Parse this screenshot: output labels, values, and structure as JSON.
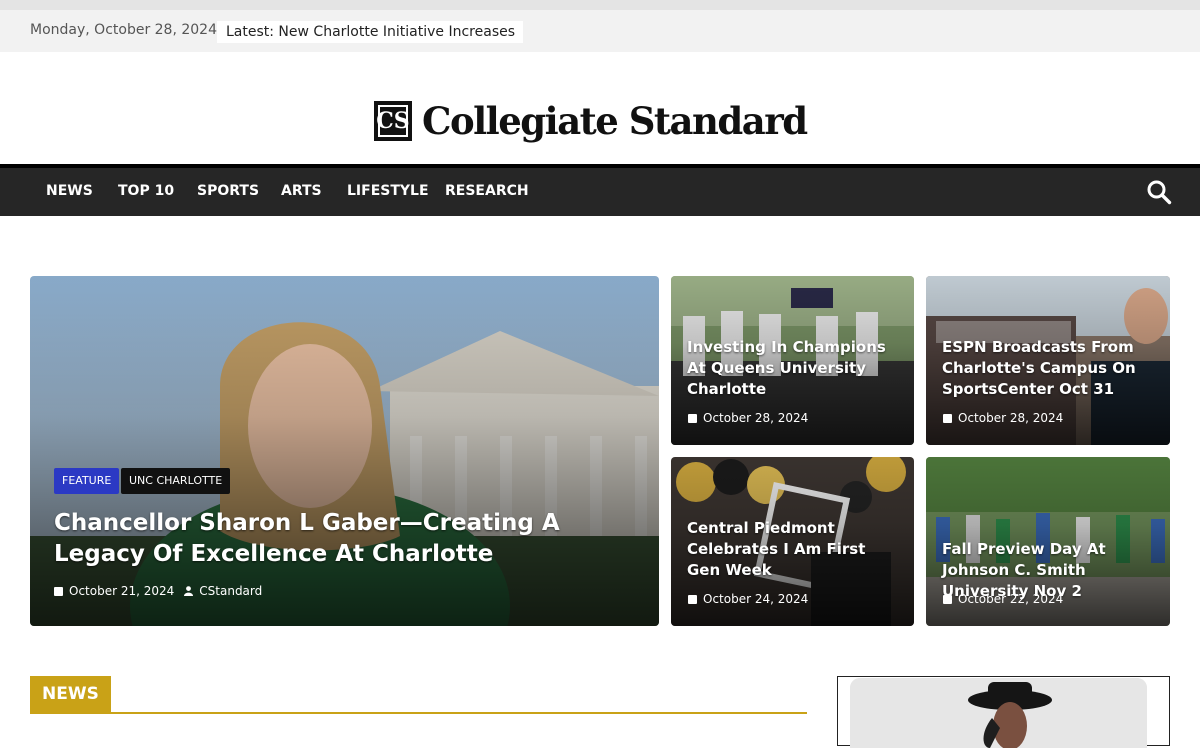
{
  "topbar": {
    "date": "Monday, October 28, 2024",
    "ticker": "Latest: New Charlotte Initiative Increases"
  },
  "site": {
    "logo_mark": "CS",
    "name": "Collegiate Standard"
  },
  "nav": {
    "items": [
      "NEWS",
      "TOP 10",
      "SPORTS",
      "ARTS",
      "LIFESTYLE",
      "RESEARCH"
    ]
  },
  "hero": {
    "badges": [
      "FEATURE",
      "UNC CHARLOTTE"
    ],
    "title": "Chancellor Sharon L Gaber—Creating A Legacy Of Excellence At Charlotte",
    "date": "October 21, 2024",
    "author": "CStandard"
  },
  "grid": [
    {
      "title": "Investing In Champions At Queens University Charlotte",
      "date": "October 28, 2024"
    },
    {
      "title": "ESPN Broadcasts From Charlotte's Campus On SportsCenter Oct 31",
      "date": "October 28, 2024"
    },
    {
      "title": "Central Piedmont Celebrates I Am First Gen Week",
      "date": "October 24, 2024"
    },
    {
      "title": "Fall Preview Day At Johnson C. Smith University Nov 2",
      "date": "October 22, 2024"
    }
  ],
  "sections": {
    "news_label": "NEWS"
  },
  "colors": {
    "accent_gold": "#c9a217",
    "badge_blue": "#2b39c4",
    "nav_bg": "#262626"
  },
  "icons": {
    "search": "search-icon",
    "calendar": "calendar-icon",
    "user": "user-icon"
  }
}
